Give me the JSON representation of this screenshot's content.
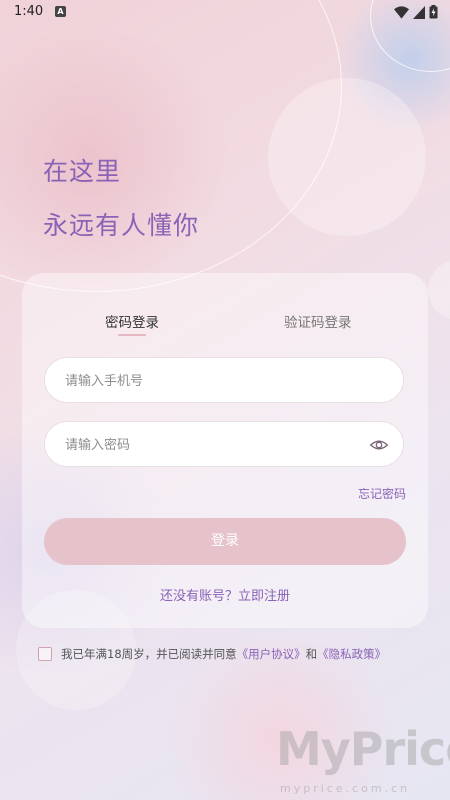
{
  "status_bar": {
    "time": "1:40",
    "notification_badge": "A",
    "icons": [
      "wifi-icon",
      "cellular-signal-icon",
      "battery-charging-icon"
    ]
  },
  "headline": {
    "line1": "在这里",
    "line2": "永远有人懂你"
  },
  "login_card": {
    "tabs": [
      {
        "label": "密码登录",
        "active": true
      },
      {
        "label": "验证码登录",
        "active": false
      }
    ],
    "phone_field": {
      "value": "",
      "placeholder": "请输入手机号"
    },
    "password_field": {
      "value": "",
      "placeholder": "请输入密码",
      "toggle_icon": "eye-icon"
    },
    "forgot_password": "忘记密码",
    "login_button": "登录",
    "register_link": "还没有账号？立即注册"
  },
  "agreement": {
    "checked": false,
    "text": "我已年满18周岁，并已阅读并同意",
    "user_agreement": "《用户协议》",
    "and": "和",
    "privacy_policy": "《隐私政策》"
  },
  "watermark": {
    "brand": "MyPrice",
    "url": "myprice.com.cn"
  },
  "colors": {
    "accent_purple": "#8a62b6",
    "button_pink": "#e6c3ca",
    "tab_underline": "#e8b8c2"
  }
}
